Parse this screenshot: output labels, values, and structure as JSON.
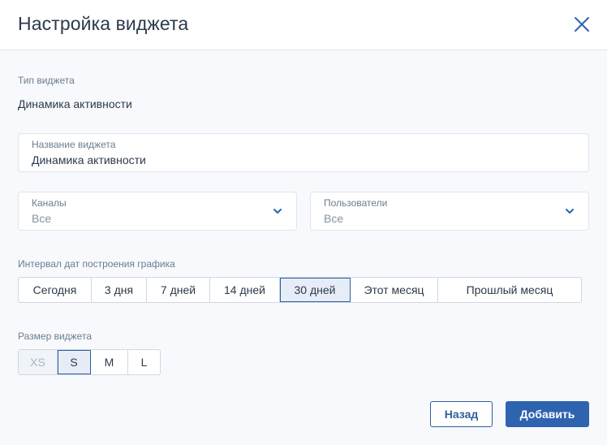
{
  "dialog": {
    "title": "Настройка виджета",
    "close_icon": "close-icon"
  },
  "widget_type": {
    "label": "Тип виджета",
    "value": "Динамика активности"
  },
  "widget_name": {
    "label": "Название виджета",
    "value": "Динамика активности"
  },
  "channels": {
    "label": "Каналы",
    "value": "Все",
    "icon": "chevron-down-icon"
  },
  "users": {
    "label": "Пользователи",
    "value": "Все",
    "icon": "chevron-down-icon"
  },
  "interval": {
    "label": "Интервал дат построения графика",
    "options": [
      "Сегодня",
      "3 дня",
      "7 дней",
      "14 дней",
      "30 дней",
      "Этот месяц",
      "Прошлый месяц"
    ],
    "selected": "30 дней"
  },
  "size": {
    "label": "Размер виджета",
    "options": [
      "XS",
      "S",
      "M",
      "L"
    ],
    "selected": "S",
    "disabled": "XS"
  },
  "actions": {
    "back_label": "Назад",
    "add_label": "Добавить"
  },
  "colors": {
    "accent": "#2e63b0",
    "border": "#dfe6ee",
    "background": "#f7f9fc"
  }
}
